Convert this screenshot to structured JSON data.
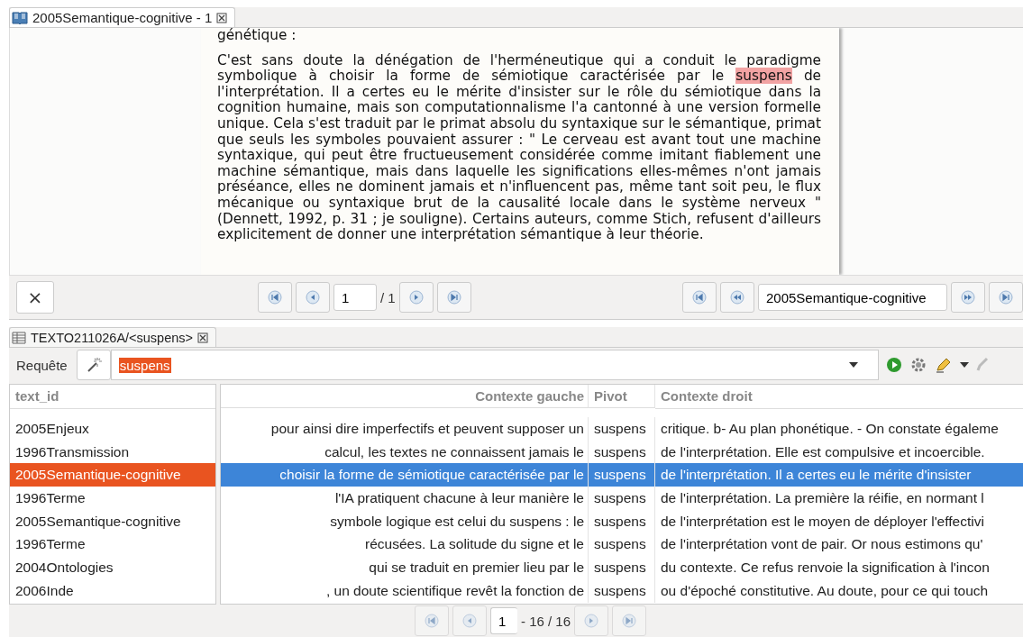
{
  "editor_tab": {
    "title": "2005Semantique-cognitive - 1"
  },
  "document": {
    "clipped_line": "génétique :",
    "paragraph": [
      {
        "text": "C'est sans doute la dénégation de l'herméneutique qui a conduit le paradigme symbolique à choisir la forme de sémiotique caractérisée par le ",
        "highlighted": false
      },
      {
        "text": "suspens",
        "highlighted": true
      },
      {
        "text": " de l'interprétation. Il a certes eu le mérite d'insister sur le rôle du sémiotique dans la cognition humaine, mais son computationnalisme l'a cantonné à une version formelle unique. Cela s'est traduit par le primat absolu du syntaxique sur le sémantique, primat que seuls les symboles pouvaient assurer : \" Le cerveau est avant tout une machine syntaxique, qui peut être fructueusement considérée comme imitant fiablement une machine sémantique, mais dans laquelle les significations elles-mêmes n'ont jamais préséance, elles ne dominent jamais et n'influencent pas, même tant soit peu, le flux mécanique ou syntaxique brut de la causalité locale dans le système nerveux \" (Dennett, 1992, p. 31 ; je souligne). Certains auteurs, comme Stich, refusent d'ailleurs explicitement de donner une interprétation sémantique à leur théorie.",
        "highlighted": false
      }
    ]
  },
  "toolbar": {
    "close_label": "×",
    "page_value": "1",
    "page_total": "/ 1",
    "document_value": "2005Semantique-cognitive"
  },
  "concordance_tab": {
    "title": "TEXTO211026A/<suspens>"
  },
  "query": {
    "label": "Requête",
    "value": "suspens"
  },
  "columns": [
    "text_id",
    "Contexte gauche",
    "Pivot",
    "Contexte droit"
  ],
  "rows": [
    {
      "text_id": "2005Enjeux",
      "left": "pour ainsi dire imperfectifs et peuvent supposer un",
      "pivot": "suspens",
      "right": "critique. b- Au plan phonétique. - On constate égaleme",
      "selected": false
    },
    {
      "text_id": "1996Transmission",
      "left": "calcul, les textes ne connaissent jamais le",
      "pivot": "suspens",
      "right": "de l'interprétation. Elle est compulsive et incoercible.",
      "selected": false
    },
    {
      "text_id": "2005Semantique-cognitive",
      "left": "choisir la forme de sémiotique caractérisée par le",
      "pivot": "suspens",
      "right": "de l'interprétation. Il a certes eu le mérite d'insister",
      "selected": true
    },
    {
      "text_id": "1996Terme",
      "left": "l'IA pratiquent chacune à leur manière le",
      "pivot": "suspens",
      "right": "de l'interprétation. La première la réifie, en normant l",
      "selected": false
    },
    {
      "text_id": "2005Semantique-cognitive",
      "left": "symbole logique est celui du suspens : le",
      "pivot": "suspens",
      "right": "de l'interprétation est le moyen de déployer l'effectivi",
      "selected": false
    },
    {
      "text_id": "1996Terme",
      "left": "récusées. La solitude du signe et le",
      "pivot": "suspens",
      "right": "de l'interprétation vont de pair. Or nous estimons qu'",
      "selected": false
    },
    {
      "text_id": "2004Ontologies",
      "left": "qui se traduit en premier lieu par le",
      "pivot": "suspens",
      "right": "du contexte. Ce refus renvoie la signification à l'incon",
      "selected": false
    },
    {
      "text_id": "2006Inde",
      "left": ", un doute scientifique revêt la fonction de",
      "pivot": "suspens",
      "right": "ou d'époché constitutive. Au doute, pour ce qui touch",
      "selected": false
    }
  ],
  "pager": {
    "value": "1",
    "total": "- 16 / 16"
  }
}
